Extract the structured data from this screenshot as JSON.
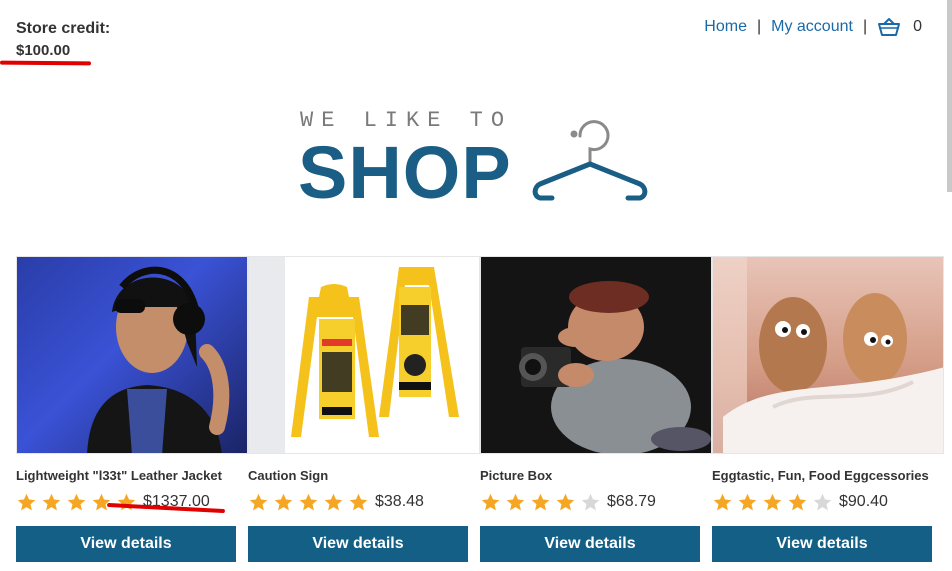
{
  "store_credit": {
    "label": "Store credit:",
    "amount": "$100.00"
  },
  "nav": {
    "home": "Home",
    "sep1": "|",
    "my_account": "My account",
    "sep2": "|",
    "cart_count": "0"
  },
  "logo": {
    "tagline": "WE LIKE TO",
    "word": "SHOP"
  },
  "products": [
    {
      "name": "Lightweight \"l33t\" Leather Jacket",
      "price": "$1337.00",
      "rating": 5,
      "button": "View details"
    },
    {
      "name": "Caution Sign",
      "price": "$38.48",
      "rating": 5,
      "button": "View details"
    },
    {
      "name": "Picture Box",
      "price": "$68.79",
      "rating": 4,
      "button": "View details"
    },
    {
      "name": "Eggtastic, Fun, Food Eggcessories",
      "price": "$90.40",
      "rating": 4,
      "button": "View details"
    }
  ],
  "colors": {
    "accent": "#135f86",
    "link": "#1a6aa8",
    "star_on": "#f5a623",
    "star_off": "#d8d8d8",
    "annotation": "#e00000"
  }
}
